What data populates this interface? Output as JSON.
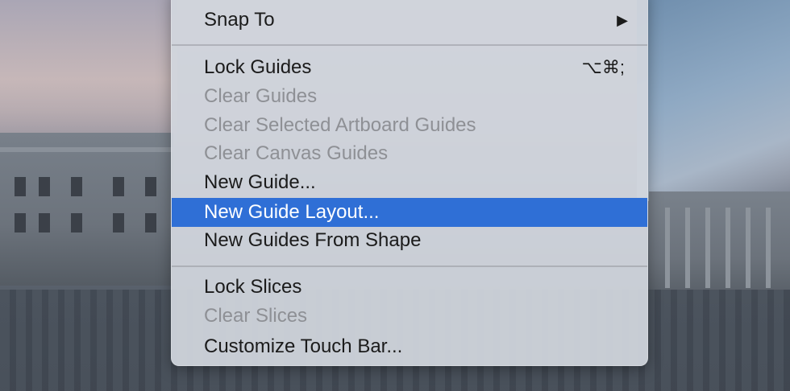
{
  "menu": {
    "items": [
      {
        "label": "Snap To",
        "enabled": true,
        "submenu": true,
        "submenu_glyph": "▶"
      },
      {
        "label": "Lock Guides",
        "enabled": true,
        "shortcut": "⌥⌘;"
      },
      {
        "label": "Clear Guides",
        "enabled": false
      },
      {
        "label": "Clear Selected Artboard Guides",
        "enabled": false
      },
      {
        "label": "Clear Canvas Guides",
        "enabled": false
      },
      {
        "label": "New Guide...",
        "enabled": true
      },
      {
        "label": "New Guide Layout...",
        "enabled": true,
        "highlighted": true
      },
      {
        "label": "New Guides From Shape",
        "enabled": true
      },
      {
        "label": "Lock Slices",
        "enabled": true
      },
      {
        "label": "Clear Slices",
        "enabled": false
      },
      {
        "label": "Customize Touch Bar...",
        "enabled": true
      }
    ]
  },
  "colors": {
    "highlight": "#2f6fd6",
    "enabled_text": "#1b1b1b",
    "disabled_text": "#8e9095"
  }
}
